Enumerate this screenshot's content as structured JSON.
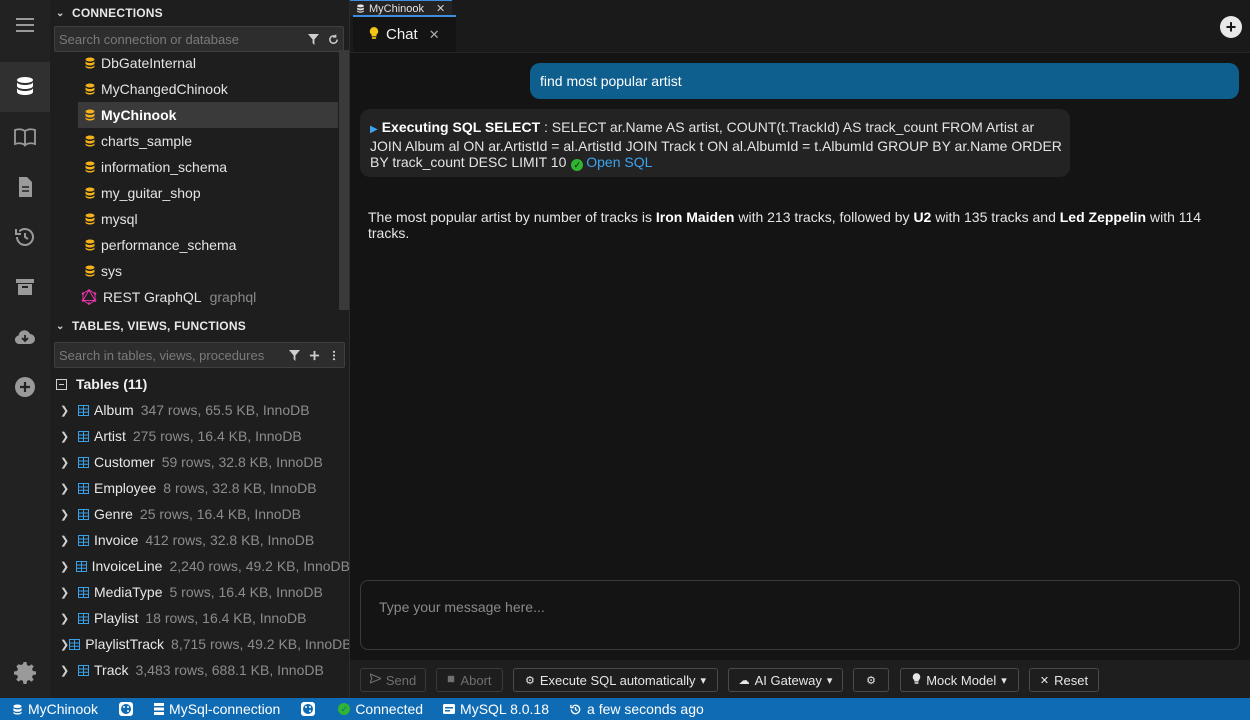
{
  "rail": {
    "items": [
      "menu",
      "database",
      "book",
      "file",
      "history",
      "archive",
      "cloud",
      "plus",
      "settings"
    ]
  },
  "connections": {
    "header": "CONNECTIONS",
    "search_placeholder": "Search connection or database",
    "items": [
      {
        "label": "DbGateInternal"
      },
      {
        "label": "MyChangedChinook"
      },
      {
        "label": "MyChinook"
      },
      {
        "label": "charts_sample"
      },
      {
        "label": "information_schema"
      },
      {
        "label": "my_guitar_shop"
      },
      {
        "label": "mysql"
      },
      {
        "label": "performance_schema"
      },
      {
        "label": "sys"
      }
    ],
    "rest": {
      "label": "REST GraphQL",
      "sub": "graphql"
    }
  },
  "tables": {
    "header": "TABLES, VIEWS, FUNCTIONS",
    "search_placeholder": "Search in tables, views, procedures",
    "group_label": "Tables (11)",
    "rows": [
      {
        "name": "Album",
        "meta": "347 rows, 65.5 KB, InnoDB"
      },
      {
        "name": "Artist",
        "meta": "275 rows, 16.4 KB, InnoDB"
      },
      {
        "name": "Customer",
        "meta": "59 rows, 32.8 KB, InnoDB"
      },
      {
        "name": "Employee",
        "meta": "8 rows, 32.8 KB, InnoDB"
      },
      {
        "name": "Genre",
        "meta": "25 rows, 16.4 KB, InnoDB"
      },
      {
        "name": "Invoice",
        "meta": "412 rows, 32.8 KB, InnoDB"
      },
      {
        "name": "InvoiceLine",
        "meta": "2,240 rows, 49.2 KB, InnoDB"
      },
      {
        "name": "MediaType",
        "meta": "5 rows, 16.4 KB, InnoDB"
      },
      {
        "name": "Playlist",
        "meta": "18 rows, 16.4 KB, InnoDB"
      },
      {
        "name": "PlaylistTrack",
        "meta": "8,715 rows, 49.2 KB, InnoDB"
      },
      {
        "name": "Track",
        "meta": "3,483 rows, 688.1 KB, InnoDB"
      }
    ]
  },
  "doc_tab": {
    "label": "MyChinook",
    "close": "✕"
  },
  "chat_tab": {
    "label": "Chat",
    "close": "✕"
  },
  "chat": {
    "user_message": "find most popular artist",
    "exec_title": "Executing SQL SELECT",
    "exec_sql": " : SELECT ar.Name AS artist, COUNT(t.TrackId) AS track_count FROM Artist ar JOIN Album al ON ar.ArtistId = al.ArtistId JOIN Track t ON al.AlbumId = t.AlbumId GROUP BY ar.Name ORDER BY track_count DESC LIMIT 10 ",
    "open_sql": "Open SQL",
    "answer_parts": {
      "p1": "The most popular artist by number of tracks is ",
      "b1": "Iron Maiden",
      "p2": " with 213 tracks, followed by ",
      "b2": "U2",
      "p3": " with 135 tracks and ",
      "b3": "Led Zeppelin",
      "p4": " with 114 tracks."
    },
    "input_placeholder": "Type your message here..."
  },
  "toolbar": {
    "send": "Send",
    "abort": "Abort",
    "execute_sql": "Execute SQL automatically",
    "gateway": "AI Gateway",
    "model": "Mock Model",
    "reset": "Reset"
  },
  "status": {
    "db": "MyChinook",
    "connection": "MySql-connection",
    "connected": "Connected",
    "server": "MySQL 8.0.18",
    "time": "a few seconds ago"
  },
  "colors": {
    "accent": "#3ca4f0",
    "statusbar": "#0f6bb3",
    "user_bubble": "#0e5f8d",
    "db_icon": "#f5b21a",
    "ok_green": "#2fb52f"
  }
}
